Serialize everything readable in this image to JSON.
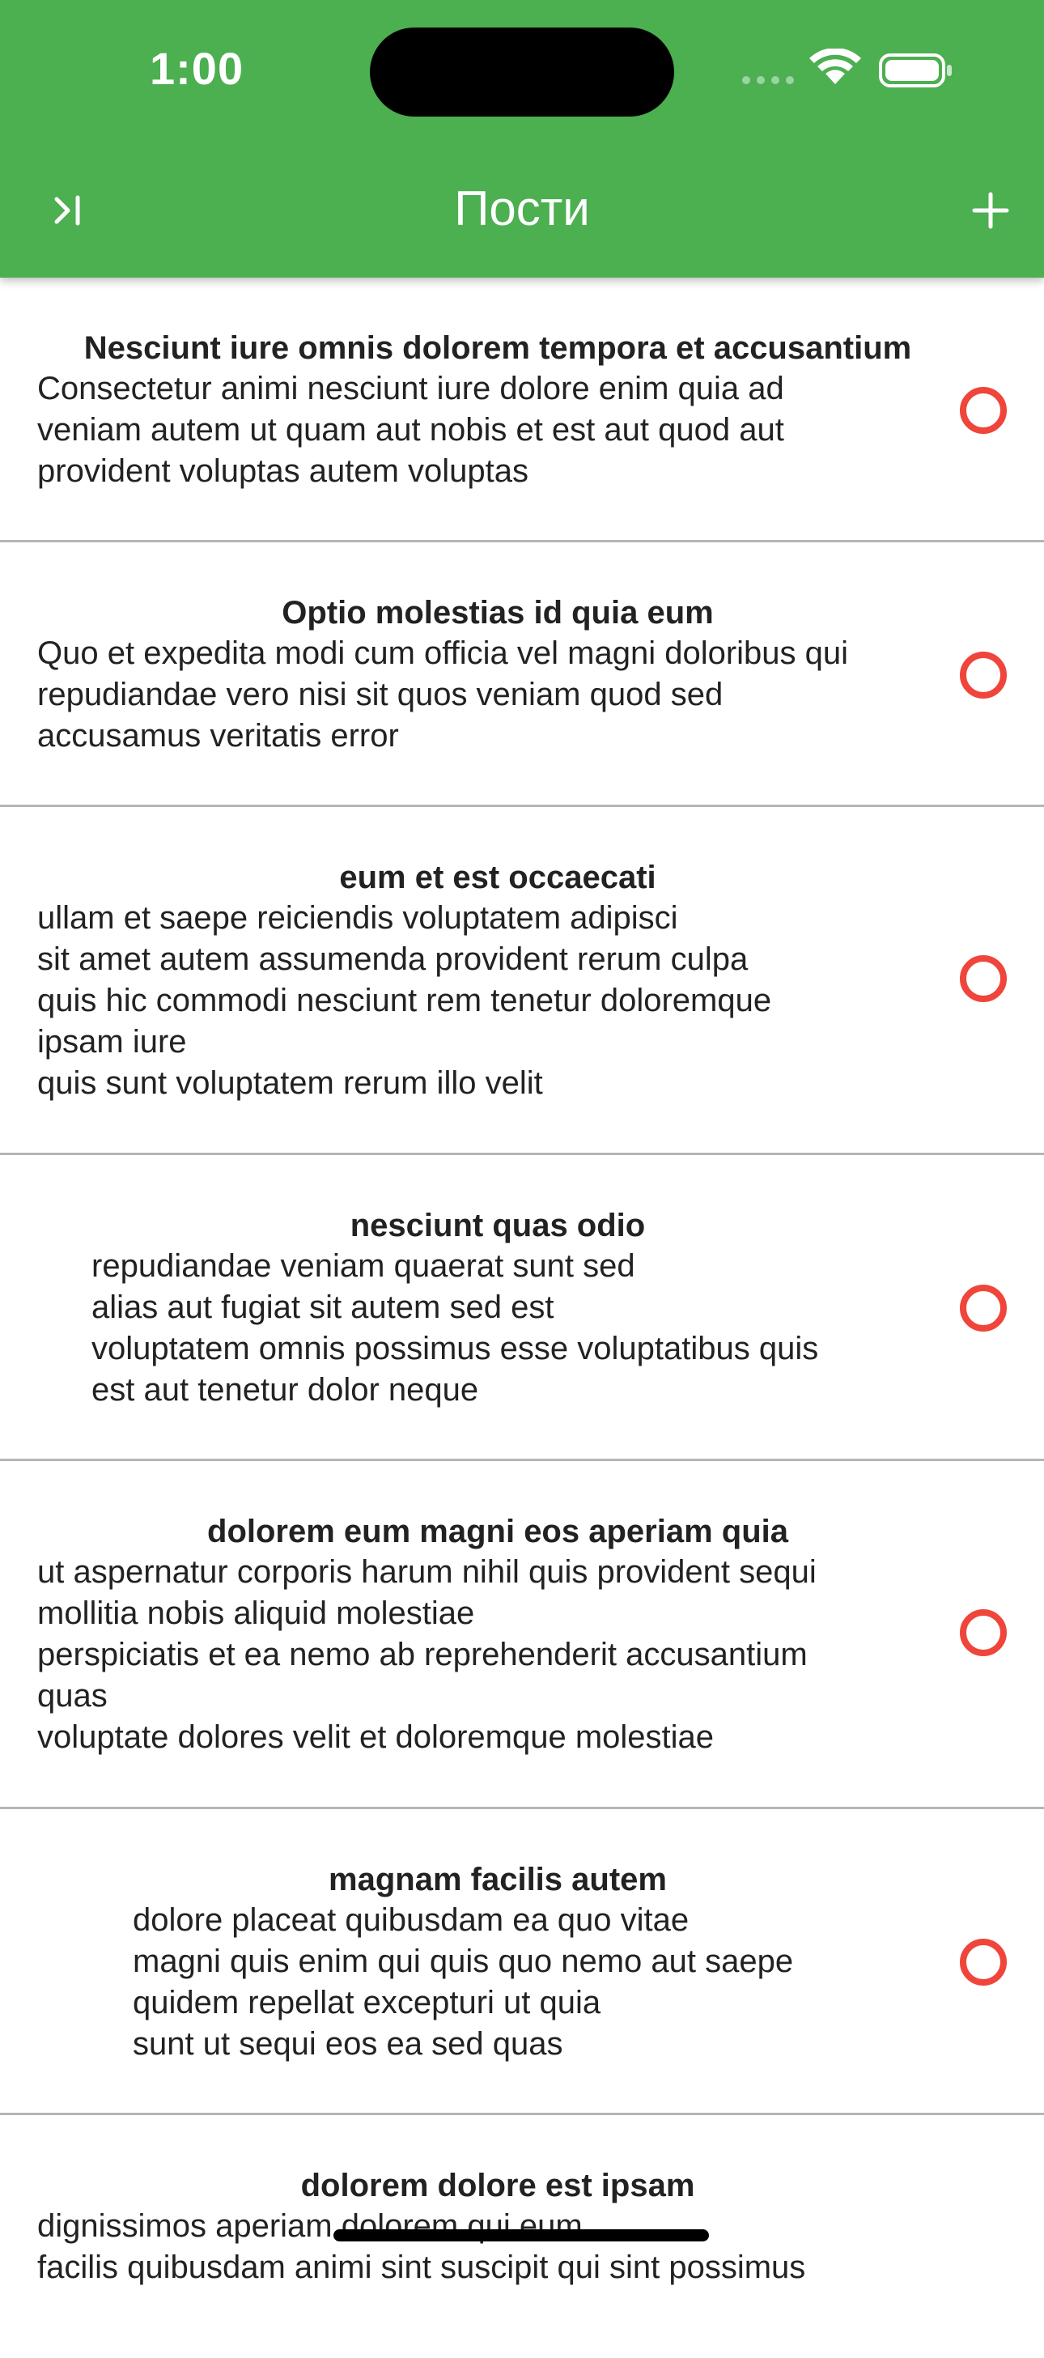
{
  "status_bar": {
    "time": "1:00"
  },
  "nav": {
    "title": "Пости",
    "left_icon": "skip-to-end-icon",
    "right_icon": "plus-icon"
  },
  "colors": {
    "header": "#4caf50",
    "radio": "#ef453b",
    "divider": "#b5b5b5"
  },
  "posts": [
    {
      "title": "Nesciunt iure omnis dolorem tempora et accusantium",
      "body": "Consectetur animi nesciunt iure dolore enim quia ad\nveniam autem ut quam aut nobis et est aut quod aut\nprovident voluptas autem voluptas"
    },
    {
      "title": "Optio molestias id quia eum",
      "body": "Quo et expedita modi cum officia vel magni doloribus qui\nrepudiandae vero nisi sit quos veniam quod sed\naccusamus veritatis error"
    },
    {
      "title": "eum et est occaecati",
      "body": "ullam et saepe reiciendis voluptatem adipisci\nsit amet autem assumenda provident rerum culpa\nquis hic commodi nesciunt rem tenetur doloremque\nipsam iure\nquis sunt voluptatem rerum illo velit"
    },
    {
      "title": "nesciunt quas odio",
      "body": "repudiandae veniam quaerat sunt sed\nalias aut fugiat sit autem sed est\nvoluptatem omnis possimus esse voluptatibus quis\nest aut tenetur dolor neque"
    },
    {
      "title": "dolorem eum magni eos aperiam quia",
      "body": "ut aspernatur corporis harum nihil quis provident sequi\nmollitia nobis aliquid molestiae\nperspiciatis et ea nemo ab reprehenderit accusantium\nquas\nvoluptate dolores velit et doloremque molestiae"
    },
    {
      "title": "magnam facilis autem",
      "body": "dolore placeat quibusdam ea quo vitae\nmagni quis enim qui quis quo nemo aut saepe\nquidem repellat excepturi ut quia\nsunt ut sequi eos ea sed quas"
    },
    {
      "title": "dolorem dolore est ipsam",
      "body": "dignissimos aperiam dolorem qui eum\nfacilis quibusdam animi sint suscipit qui sint possimus"
    }
  ]
}
